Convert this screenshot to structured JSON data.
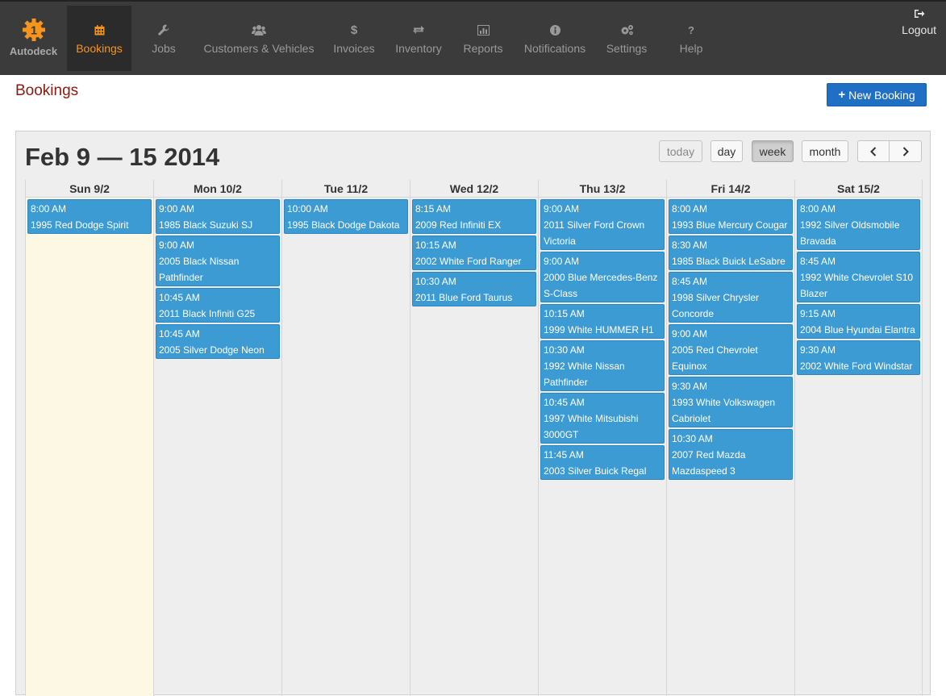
{
  "app": {
    "name": "Autodeck"
  },
  "nav": {
    "items": [
      {
        "label": "Bookings",
        "icon": "calendar-icon",
        "active": true
      },
      {
        "label": "Jobs",
        "icon": "wrench-icon"
      },
      {
        "label": "Customers & Vehicles",
        "icon": "users-icon"
      },
      {
        "label": "Invoices",
        "icon": "dollar-icon"
      },
      {
        "label": "Inventory",
        "icon": "exchange-icon"
      },
      {
        "label": "Reports",
        "icon": "bar-chart-icon"
      },
      {
        "label": "Notifications",
        "icon": "info-icon"
      },
      {
        "label": "Settings",
        "icon": "cogs-icon"
      },
      {
        "label": "Help",
        "icon": "question-icon"
      }
    ],
    "logout": "Logout"
  },
  "page": {
    "title": "Bookings",
    "new_button": "New Booking"
  },
  "calendar": {
    "range_title": "Feb 9 — 15 2014",
    "buttons": {
      "today": "today",
      "day": "day",
      "week": "week",
      "month": "month",
      "prev": "‹",
      "next": "›"
    },
    "view": "week",
    "days": [
      {
        "label": "Sun 9/2",
        "today": true,
        "events": [
          {
            "time": "8:00 AM",
            "title": "1995 Red Dodge Spirit"
          }
        ]
      },
      {
        "label": "Mon 10/2",
        "events": [
          {
            "time": "9:00 AM",
            "title": "1985 Black Suzuki SJ"
          },
          {
            "time": "9:00 AM",
            "title": "2005 Black Nissan Pathfinder"
          },
          {
            "time": "10:45 AM",
            "title": "2011 Black Infiniti G25"
          },
          {
            "time": "10:45 AM",
            "title": "2005 Silver Dodge Neon"
          }
        ]
      },
      {
        "label": "Tue 11/2",
        "events": [
          {
            "time": "10:00 AM",
            "title": "1995 Black Dodge Dakota"
          }
        ]
      },
      {
        "label": "Wed 12/2",
        "events": [
          {
            "time": "8:15 AM",
            "title": "2009 Red Infiniti EX"
          },
          {
            "time": "10:15 AM",
            "title": "2002 White Ford Ranger"
          },
          {
            "time": "10:30 AM",
            "title": "2011 Blue Ford Taurus"
          }
        ]
      },
      {
        "label": "Thu 13/2",
        "events": [
          {
            "time": "9:00 AM",
            "title": "2011 Silver Ford Crown Victoria"
          },
          {
            "time": "9:00 AM",
            "title": "2000 Blue Mercedes-Benz S-Class"
          },
          {
            "time": "10:15 AM",
            "title": "1999 White HUMMER H1"
          },
          {
            "time": "10:30 AM",
            "title": "1992 White Nissan Pathfinder"
          },
          {
            "time": "10:45 AM",
            "title": "1997 White Mitsubishi 3000GT"
          },
          {
            "time": "11:45 AM",
            "title": "2003 Silver Buick Regal"
          }
        ]
      },
      {
        "label": "Fri 14/2",
        "events": [
          {
            "time": "8:00 AM",
            "title": "1993 Blue Mercury Cougar"
          },
          {
            "time": "8:30 AM",
            "title": "1985 Black Buick LeSabre"
          },
          {
            "time": "8:45 AM",
            "title": "1998 Silver Chrysler Concorde"
          },
          {
            "time": "9:00 AM",
            "title": "2005 Red Chevrolet Equinox"
          },
          {
            "time": "9:30 AM",
            "title": "1993 White Volkswagen Cabriolet"
          },
          {
            "time": "10:30 AM",
            "title": "2007 Red Mazda Mazdaspeed 3"
          }
        ]
      },
      {
        "label": "Sat 15/2",
        "events": [
          {
            "time": "8:00 AM",
            "title": "1992 Silver Oldsmobile Bravada"
          },
          {
            "time": "8:45 AM",
            "title": "1992 White Chevrolet S10 Blazer"
          },
          {
            "time": "9:15 AM",
            "title": "2004 Blue Hyundai Elantra"
          },
          {
            "time": "9:30 AM",
            "title": "2002 White Ford Windstar"
          }
        ]
      }
    ]
  },
  "colors": {
    "nav_bg": "#3b3b3b",
    "accent": "#f7941d",
    "event": "#3d9bd3",
    "title": "#8b1a10",
    "primary_button": "#1f6fc4"
  }
}
